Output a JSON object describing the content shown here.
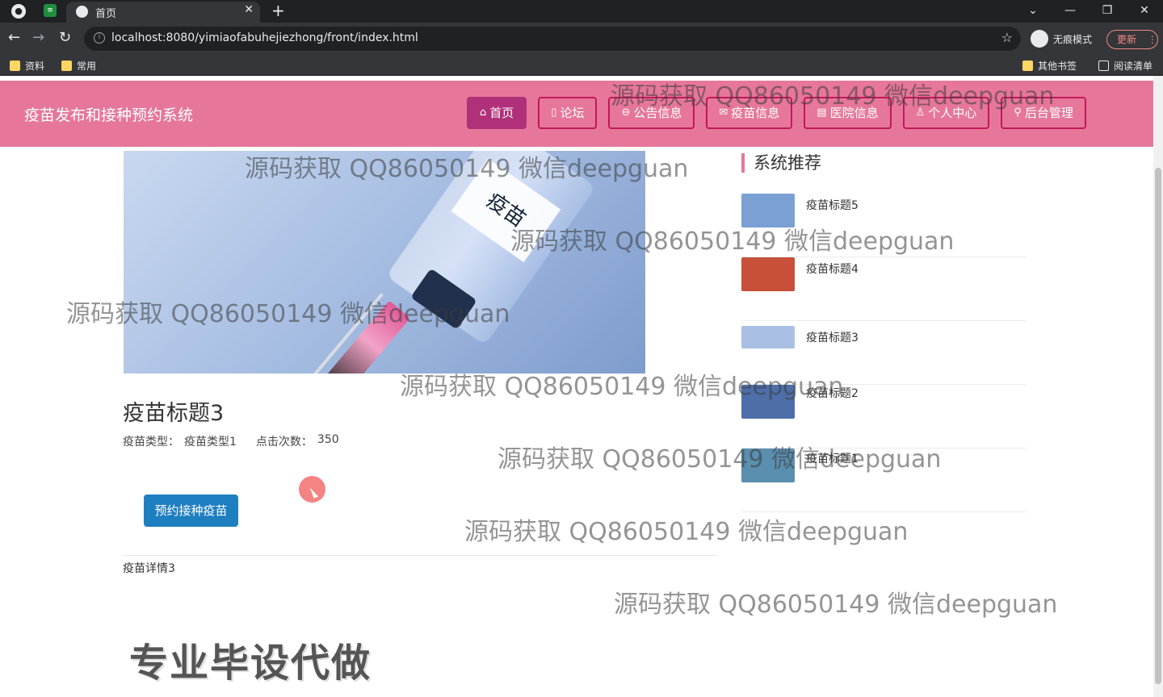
{
  "browser": {
    "tab_title": "首页",
    "url_host": "localhost:8080/yimiaofabuhejiezhong/front/index.html",
    "incognito_label": "无痕模式",
    "update_label": "更新",
    "bookmarks": [
      "资料",
      "常用"
    ],
    "bookmarks_right": [
      "其他书签",
      "阅读清单"
    ]
  },
  "site": {
    "title": "疫苗发布和接种预约系统",
    "nav": [
      {
        "label": "首页",
        "icon": "home-icon",
        "glyph": "⌂"
      },
      {
        "label": "论坛",
        "icon": "forum-icon",
        "glyph": "▯"
      },
      {
        "label": "公告信息",
        "icon": "announcement-icon",
        "glyph": "⊖"
      },
      {
        "label": "疫苗信息",
        "icon": "mail-icon",
        "glyph": "✉"
      },
      {
        "label": "医院信息",
        "icon": "hospital-icon",
        "glyph": "▤"
      },
      {
        "label": "个人中心",
        "icon": "user-icon",
        "glyph": "♙"
      },
      {
        "label": "后台管理",
        "icon": "link-icon",
        "glyph": "⚲"
      }
    ]
  },
  "detail": {
    "title": "疫苗标题3",
    "type_label": "疫苗类型：",
    "type_value": "疫苗类型1",
    "clicks_label": "点击次数：",
    "clicks_value": "350",
    "book_button": "预约接种疫苗",
    "body": "疫苗详情3",
    "hero_image_text": "疫苗"
  },
  "sidebar": {
    "heading": "系统推荐",
    "items": [
      {
        "title": "疫苗标题5",
        "color": "#7aa0d4"
      },
      {
        "title": "疫苗标题4",
        "color": "#c8503a"
      },
      {
        "title": "疫苗标题3",
        "color": "#a9c0e4"
      },
      {
        "title": "疫苗标题2",
        "color": "#4d6ea8"
      },
      {
        "title": "疫苗标题1",
        "color": "#5a8fb0"
      }
    ]
  },
  "overlay": {
    "watermark": "源码获取 QQ86050149 微信deepguan",
    "promo": "专业毕设代做"
  }
}
